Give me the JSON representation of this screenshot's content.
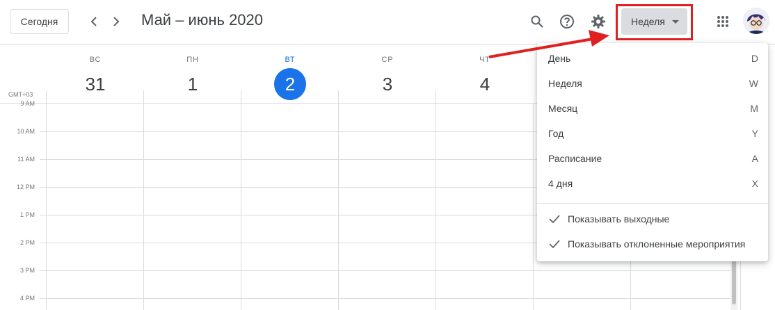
{
  "header": {
    "today_label": "Сегодня",
    "date_range": "Май – июнь 2020",
    "view_label": "Неделя",
    "icons": [
      "chevron-left-icon",
      "chevron-right-icon",
      "search-icon",
      "help-icon",
      "gear-icon",
      "apps-icon"
    ]
  },
  "days": [
    {
      "dow": "ВС",
      "num": "31"
    },
    {
      "dow": "ПН",
      "num": "1"
    },
    {
      "dow": "ВТ",
      "num": "2",
      "today": true
    },
    {
      "dow": "СР",
      "num": "3"
    },
    {
      "dow": "ЧТ",
      "num": "4"
    }
  ],
  "timezone": "GMT+03",
  "hours": [
    "9 AM",
    "10 AM",
    "11 AM",
    "12 PM",
    "1 PM",
    "2 PM",
    "3 PM",
    "4 PM"
  ],
  "menu": {
    "items": [
      {
        "label": "День",
        "key": "D"
      },
      {
        "label": "Неделя",
        "key": "W"
      },
      {
        "label": "Месяц",
        "key": "M"
      },
      {
        "label": "Год",
        "key": "Y"
      },
      {
        "label": "Расписание",
        "key": "A"
      },
      {
        "label": "4 дня",
        "key": "X"
      }
    ],
    "checks": [
      {
        "label": "Показывать выходные",
        "checked": true
      },
      {
        "label": "Показывать отклоненные мероприятия",
        "checked": true
      }
    ]
  },
  "colors": {
    "accent": "#1a73e8",
    "highlight": "#e02020",
    "view_button_bg": "#dadce0"
  }
}
